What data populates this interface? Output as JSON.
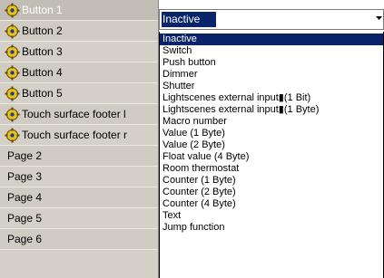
{
  "tree": {
    "items": [
      {
        "label": "Button 1",
        "icon": "gear-icon",
        "selected": true
      },
      {
        "label": "Button 2",
        "icon": "gear-icon"
      },
      {
        "label": "Button 3",
        "icon": "gear-icon"
      },
      {
        "label": "Button 4",
        "icon": "gear-icon"
      },
      {
        "label": "Button 5",
        "icon": "gear-icon"
      },
      {
        "label": "Touch surface footer l",
        "icon": "gear-icon"
      },
      {
        "label": "Touch surface footer r",
        "icon": "gear-icon"
      },
      {
        "label": "Page 2"
      },
      {
        "label": "Page 3"
      },
      {
        "label": "Page 4"
      },
      {
        "label": "Page 5"
      },
      {
        "label": "Page 6"
      }
    ]
  },
  "combo": {
    "value": "Inactive"
  },
  "dropdown": {
    "options": [
      "Inactive",
      "Switch",
      "Push button",
      "Dimmer",
      "Shutter",
      "Lightscenes external input▮(1 Bit)",
      "Lightscenes external input▮(1 Byte)",
      "Macro number",
      "Value (1 Byte)",
      "Value (2 Byte)",
      "Float value (4 Byte)",
      "Room thermostat",
      "Counter (1 Byte)",
      "Counter (2 Byte)",
      "Counter (4 Byte)",
      "Text",
      "Jump function"
    ],
    "highlighted": "Inactive"
  },
  "colors": {
    "selection": "#0a246a",
    "panel": "#d4d0c8",
    "gear_yellow": "#e8c21c"
  }
}
